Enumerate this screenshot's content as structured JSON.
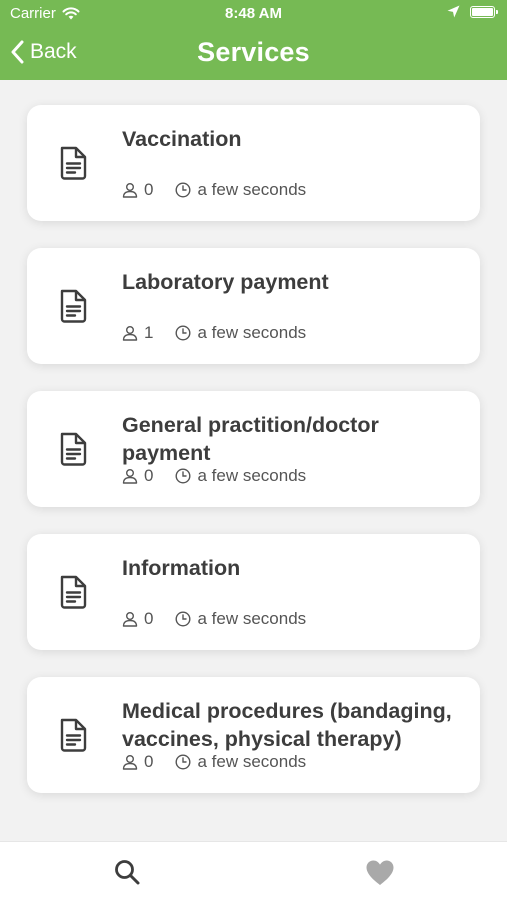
{
  "status_bar": {
    "carrier": "Carrier",
    "time": "8:48 AM"
  },
  "nav": {
    "back_label": "Back",
    "title": "Services"
  },
  "services": [
    {
      "title": "Vaccination",
      "count": "0",
      "time": "a few seconds"
    },
    {
      "title": "Laboratory payment",
      "count": "1",
      "time": "a few seconds"
    },
    {
      "title": "General practition/doctor payment",
      "count": "0",
      "time": "a few seconds"
    },
    {
      "title": "Information",
      "count": "0",
      "time": "a few seconds"
    },
    {
      "title": "Medical procedures (bandaging, vaccines, physical therapy)",
      "count": "0",
      "time": "a few seconds"
    }
  ],
  "tabbar": {
    "items": [
      "search-icon",
      "heart-icon"
    ]
  },
  "colors": {
    "header": "#76ba54",
    "card": "#ffffff",
    "background": "#f2f2f2",
    "text": "#3d3d3d",
    "heart_inactive": "#a9a9a9"
  }
}
